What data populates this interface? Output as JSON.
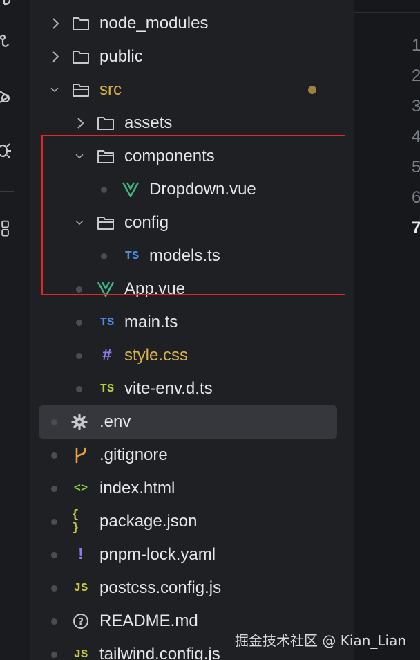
{
  "explorer": {
    "items": [
      {
        "label": "node_modules",
        "icon": "folder-icon"
      },
      {
        "label": "public",
        "icon": "folder-icon"
      },
      {
        "label": "src",
        "icon": "folder-open-icon"
      },
      {
        "label": "assets",
        "icon": "folder-icon"
      },
      {
        "label": "components",
        "icon": "folder-open-icon"
      },
      {
        "label": "Dropdown.vue",
        "icon": "vue-icon"
      },
      {
        "label": "config",
        "icon": "folder-open-icon"
      },
      {
        "label": "models.ts",
        "icon": "typescript-icon",
        "icon_text": "TS"
      },
      {
        "label": "App.vue",
        "icon": "vue-icon"
      },
      {
        "label": "main.ts",
        "icon": "typescript-icon",
        "icon_text": "TS"
      },
      {
        "label": "style.css",
        "icon": "css-hash-icon",
        "icon_text": "#"
      },
      {
        "label": "vite-env.d.ts",
        "icon": "typescript-dts-icon",
        "icon_text": "TS"
      },
      {
        "label": ".env",
        "icon": "gear-icon"
      },
      {
        "label": ".gitignore",
        "icon": "git-branch-icon"
      },
      {
        "label": "index.html",
        "icon": "html-code-icon",
        "icon_text": "<>"
      },
      {
        "label": "package.json",
        "icon": "json-braces-icon",
        "icon_text": "{ }"
      },
      {
        "label": "pnpm-lock.yaml",
        "icon": "exclamation-icon",
        "icon_text": "!"
      },
      {
        "label": "postcss.config.js",
        "icon": "javascript-icon",
        "icon_text": "JS"
      },
      {
        "label": "README.md",
        "icon": "question-circle-icon",
        "icon_text": "?"
      },
      {
        "label": "tailwind.config.js",
        "icon": "javascript-icon",
        "icon_text": "JS"
      }
    ],
    "selected_item": ".env",
    "highlighted_group": [
      "components",
      "Dropdown.vue",
      "config",
      "models.ts",
      "App.vue"
    ]
  },
  "editor": {
    "line_numbers": [
      "1",
      "2",
      "3",
      "4",
      "5",
      "6",
      "7"
    ],
    "active_line": "7"
  },
  "watermark": "掘金技术社区 @ Kian_Lian",
  "colors": {
    "background": "#1f2024",
    "text": "#e4e6ea",
    "modified": "#d7b34a",
    "vue_green": "#41b883",
    "ts_blue": "#4a8ee6",
    "js_yellow": "#cbcb41",
    "highlight_red": "#e3252e",
    "selection": "#35373d"
  }
}
